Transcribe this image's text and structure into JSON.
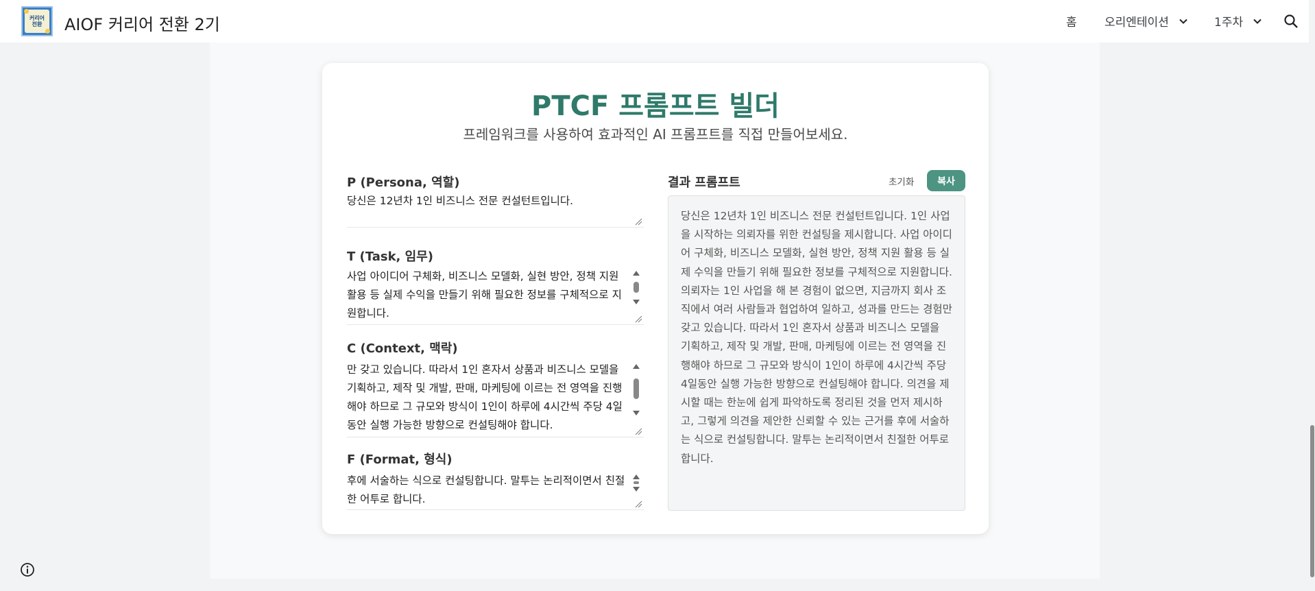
{
  "header": {
    "logo_text_line1": "커리어",
    "logo_text_line2": "전환",
    "site_title": "AIOF 커리어 전환 2기",
    "nav": [
      {
        "label": "홈"
      },
      {
        "label": "오리엔테이션"
      },
      {
        "label": "1주차"
      }
    ]
  },
  "card": {
    "title": "PTCF 프롬프트 빌더",
    "subtitle": "프레임워크를 사용하여 효과적인 AI 프롬프트를 직접 만들어보세요.",
    "fields": {
      "persona": {
        "label": "P (Persona, 역할)",
        "value": "당신은 12년차 1인 비즈니스 전문 컨설턴트입니다."
      },
      "task": {
        "label": "T (Task, 임무)",
        "value": "사업 아이디어 구체화, 비즈니스 모델화, 실현 방안, 정책 지원 활용 등 실제 수익을 만들기 위해 필요한 정보를 구체적으로 지원합니다."
      },
      "context": {
        "label": "C (Context, 맥락)",
        "value": "만 갖고 있습니다. 따라서 1인 혼자서 상품과 비즈니스 모델을 기획하고, 제작 및 개발, 판매, 마케팅에 이르는 전 영역을 진행해야 하므로 그 규모와 방식이 1인이 하루에 4시간씩 주당 4일동안 실행 가능한 방향으로 컨설팅해야 합니다."
      },
      "format": {
        "label": "F (Format, 형식)",
        "value": "후에 서술하는 식으로 컨설팅합니다. 말투는 논리적이면서 친절한 어투로 합니다."
      }
    },
    "result": {
      "label": "결과 프롬프트",
      "reset_label": "초기화",
      "copy_label": "복사",
      "text": "당신은 12년차 1인 비즈니스 전문 컨설턴트입니다. 1인 사업을 시작하는 의뢰자를 위한 컨설팅을 제시합니다. 사업 아이디어 구체화, 비즈니스 모델화, 실현 방안, 정책 지원 활용 등 실제 수익을 만들기 위해 필요한 정보를 구체적으로 지원합니다. 의뢰자는 1인 사업을 해 본 경험이 없으면, 지금까지 회사 조직에서 여러 사람들과 협업하여 일하고, 성과를 만드는 경험만 갖고 있습니다. 따라서 1인 혼자서 상품과 비즈니스 모델을 기획하고, 제작 및 개발, 판매, 마케팅에 이르는 전 영역을 진행해야 하므로 그 규모와 방식이 1인이 하루에 4시간씩 주당 4일동안 실행 가능한 방향으로 컨설팅해야 합니다. 의견을 제시할 때는 한눈에 쉽게 파악하도록 정리된 것을 먼저 제시하고, 그렇게 의견을 제안한 신뢰할 수 있는 근거를 후에 서술하는 식으로 컨설팅합니다. 말투는 논리적이면서 친절한 어투로 합니다."
    }
  },
  "colors": {
    "accent": "#2f7a6a",
    "copy_button": "#4d9482"
  },
  "icons": [
    "chevron-down-icon",
    "search-icon",
    "info-icon",
    "resize-handle-icon",
    "scroll-arrow-icon"
  ]
}
